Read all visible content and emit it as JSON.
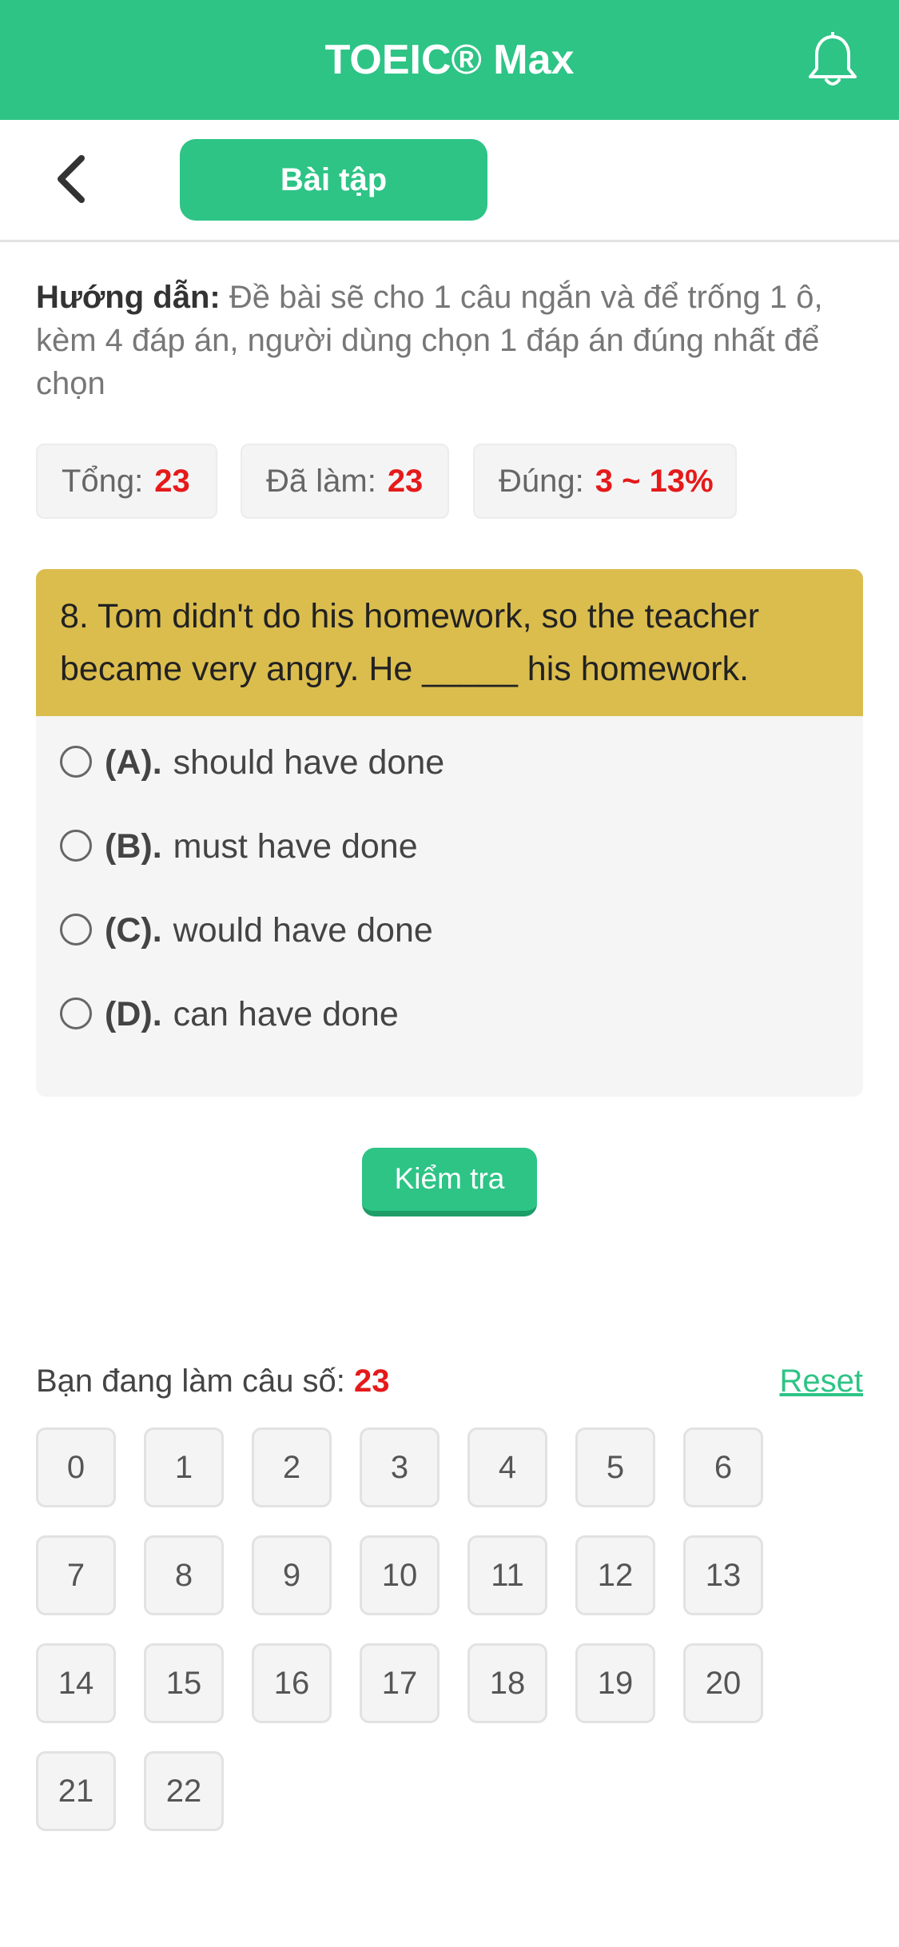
{
  "header": {
    "title": "TOEIC® Max",
    "bell_icon": "bell-icon"
  },
  "subbar": {
    "back_icon": "chevron-left-icon",
    "tab_label": "Bài tập"
  },
  "instructions": {
    "label": "Hướng dẫn:",
    "text": "Đề bài sẽ cho 1 câu ngắn và để trống 1 ô, kèm 4 đáp án, người dùng chọn 1 đáp án đúng nhất để chọn"
  },
  "stats": {
    "total_label": "Tổng:",
    "total_value": "23",
    "done_label": "Đã làm:",
    "done_value": "23",
    "correct_label": "Đúng:",
    "correct_value": "3 ~ 13%"
  },
  "question": {
    "text": "8. Tom didn't do his homework, so the teacher became very angry. He _____ his homework.",
    "options": [
      {
        "letter": "(A).",
        "text": "should have done"
      },
      {
        "letter": "(B).",
        "text": "must have done"
      },
      {
        "letter": "(C).",
        "text": "would have done"
      },
      {
        "letter": "(D).",
        "text": "can have done"
      }
    ]
  },
  "check_button": "Kiểm tra",
  "progress": {
    "label": "Bạn đang làm câu số:",
    "current": "23",
    "reset_label": "Reset"
  },
  "question_numbers": [
    "0",
    "1",
    "2",
    "3",
    "4",
    "5",
    "6",
    "7",
    "8",
    "9",
    "10",
    "11",
    "12",
    "13",
    "14",
    "15",
    "16",
    "17",
    "18",
    "19",
    "20",
    "21",
    "22"
  ],
  "colors": {
    "primary": "#2dc486",
    "question_header": "#dbbd4e",
    "highlight": "#e51a1a"
  }
}
